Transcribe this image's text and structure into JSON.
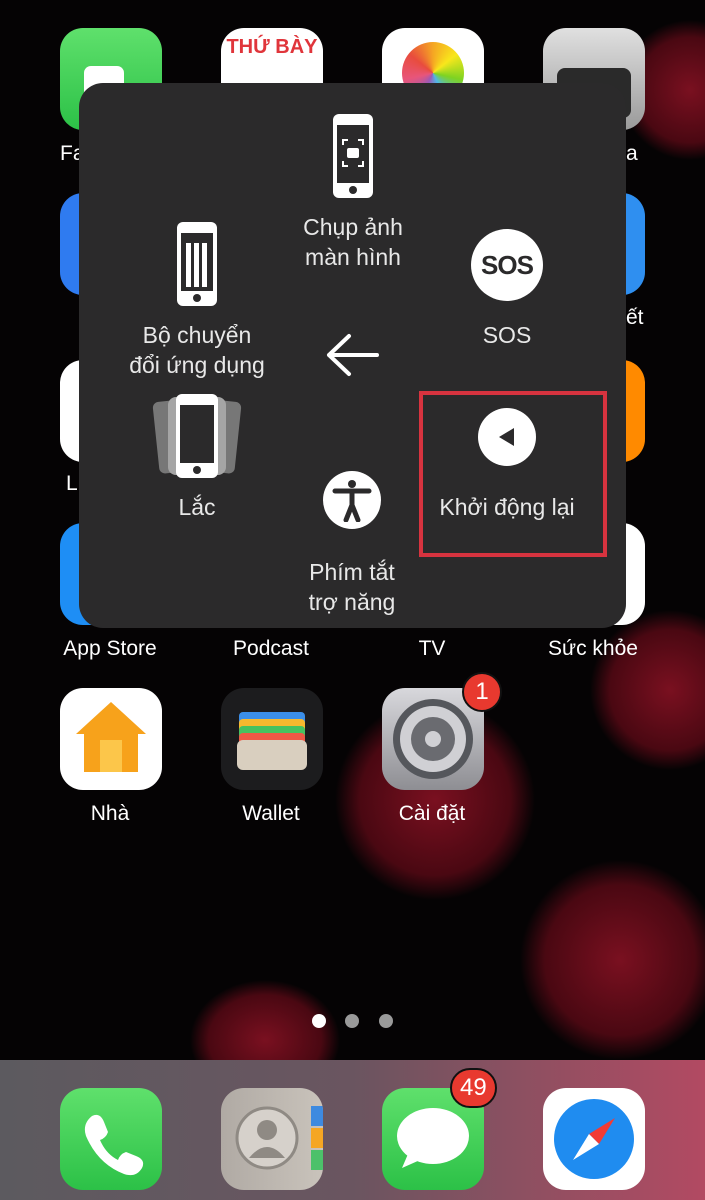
{
  "home": {
    "calendar_day": "THỨ BÀY",
    "partial_labels": {
      "left_row1": "Fa",
      "right_row1": "a",
      "right_row2": "ết",
      "left_row3": "L"
    },
    "apps": [
      {
        "label": "App Store",
        "icon": "app-store-icon"
      },
      {
        "label": "Podcast",
        "icon": "podcast-icon"
      },
      {
        "label": "TV",
        "icon": "tv-icon"
      },
      {
        "label": "Sức khỏe",
        "icon": "health-icon"
      },
      {
        "label": "Nhà",
        "icon": "home-icon"
      },
      {
        "label": "Wallet",
        "icon": "wallet-icon"
      },
      {
        "label": "Cài đặt",
        "icon": "settings-icon",
        "badge": "1"
      }
    ],
    "page_dots": 3,
    "active_page": 1
  },
  "dock": {
    "apps": [
      {
        "name": "phone",
        "icon": "phone-icon"
      },
      {
        "name": "contacts",
        "icon": "contacts-icon"
      },
      {
        "name": "messages",
        "icon": "messages-icon",
        "badge": "49"
      },
      {
        "name": "safari",
        "icon": "safari-icon"
      }
    ]
  },
  "assistive_menu": {
    "screenshot": {
      "line1": "Chụp ảnh",
      "line2": "màn hình"
    },
    "app_switcher": {
      "line1": "Bộ chuyển",
      "line2": "đổi ứng dụng"
    },
    "sos": {
      "icon_text": "SOS",
      "label": "SOS"
    },
    "shake": {
      "label": "Lắc"
    },
    "restart": {
      "label": "Khởi động lại"
    },
    "accessibility_shortcut": {
      "line1": "Phím tắt",
      "line2": "trợ năng"
    },
    "highlight_color": "#d7333f"
  }
}
